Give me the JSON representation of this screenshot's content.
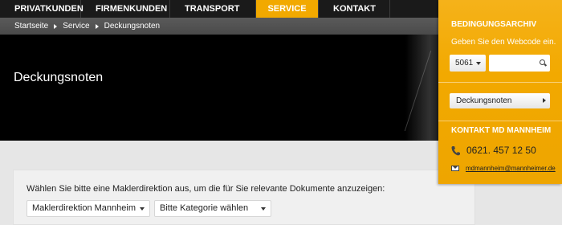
{
  "nav": {
    "items": [
      {
        "label": "PRIVATKUNDEN",
        "active": false
      },
      {
        "label": "FIRMENKUNDEN",
        "active": false
      },
      {
        "label": "TRANSPORT",
        "active": false
      },
      {
        "label": "SERVICE",
        "active": true
      },
      {
        "label": "KONTAKT",
        "active": false
      }
    ]
  },
  "breadcrumb": [
    "Startseite",
    "Service",
    "Deckungsnoten"
  ],
  "hero": {
    "title": "Deckungsnoten"
  },
  "content": {
    "intro": "Wählen Sie bitte eine Maklerdirektion aus, um die für Sie relevante Dokumente anzuzeigen:",
    "direktion_select": "Maklerdirektion Mannheim",
    "kategorie_select": "Bitte Kategorie wählen"
  },
  "panel": {
    "archive_title": "BEDINGUNGSARCHIV",
    "hint": "Geben Sie den Webcode ein.",
    "code_select": "5061",
    "code_input_value": "",
    "doc_button": "Deckungsnoten",
    "contact_title": "KONTAKT MD MANNHEIM",
    "phone": "0621. 457 12 50",
    "email": "mdmannheim@mannheimer.de"
  },
  "colors": {
    "accent": "#f2a900",
    "nav_bg": "#1a1a1a",
    "hero_bg": "#000000"
  },
  "icons": [
    "search-icon",
    "phone-icon",
    "mail-icon",
    "chevron-right-icon",
    "chevron-down-icon"
  ]
}
